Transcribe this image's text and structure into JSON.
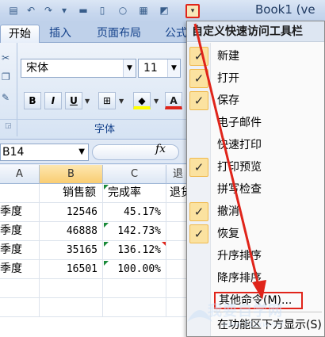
{
  "window": {
    "title": "Book1 (ve"
  },
  "qat": {
    "dropdown_glyph": "▾"
  },
  "ribbon": {
    "tabs": [
      "开始",
      "插入",
      "页面布局",
      "公式"
    ],
    "font_name": "宋体",
    "font_size": "11",
    "bold": "B",
    "italic": "I",
    "underline": "U",
    "font_color_letter": "A",
    "group_label": "字体"
  },
  "formula_bar": {
    "name_box": "B14",
    "fx": "fx"
  },
  "sheet": {
    "columns": [
      "A",
      "B",
      "C",
      "退"
    ],
    "header_row": [
      "",
      "销售额",
      "完成率",
      "退货"
    ],
    "rows": [
      [
        "季度",
        "12546",
        "45.17%"
      ],
      [
        "季度",
        "46888",
        "142.73%"
      ],
      [
        "季度",
        "35165",
        "136.12%"
      ],
      [
        "季度",
        "16501",
        "100.00%"
      ]
    ]
  },
  "menu": {
    "title": "自定义快速访问工具栏",
    "items": [
      {
        "label": "新建",
        "checked": true
      },
      {
        "label": "打开",
        "checked": true
      },
      {
        "label": "保存",
        "checked": true
      },
      {
        "label": "电子邮件",
        "checked": false
      },
      {
        "label": "快速打印",
        "checked": false
      },
      {
        "label": "打印预览",
        "checked": true
      },
      {
        "label": "拼写检查",
        "checked": false
      },
      {
        "label": "撤消",
        "checked": true
      },
      {
        "label": "恢复",
        "checked": true
      },
      {
        "label": "升序排序",
        "checked": false
      },
      {
        "label": "降序排序",
        "checked": false
      }
    ],
    "more_commands": "其他命令(M)...",
    "show_below": "在功能区下方显示(S)"
  },
  "colors": {
    "highlight_red": "#e0241a",
    "check_bg": "#fbe2a0",
    "accent_blue": "#15428b"
  },
  "watermark": {
    "text": "我要自学网",
    "sub": "www.51zxw.net"
  }
}
